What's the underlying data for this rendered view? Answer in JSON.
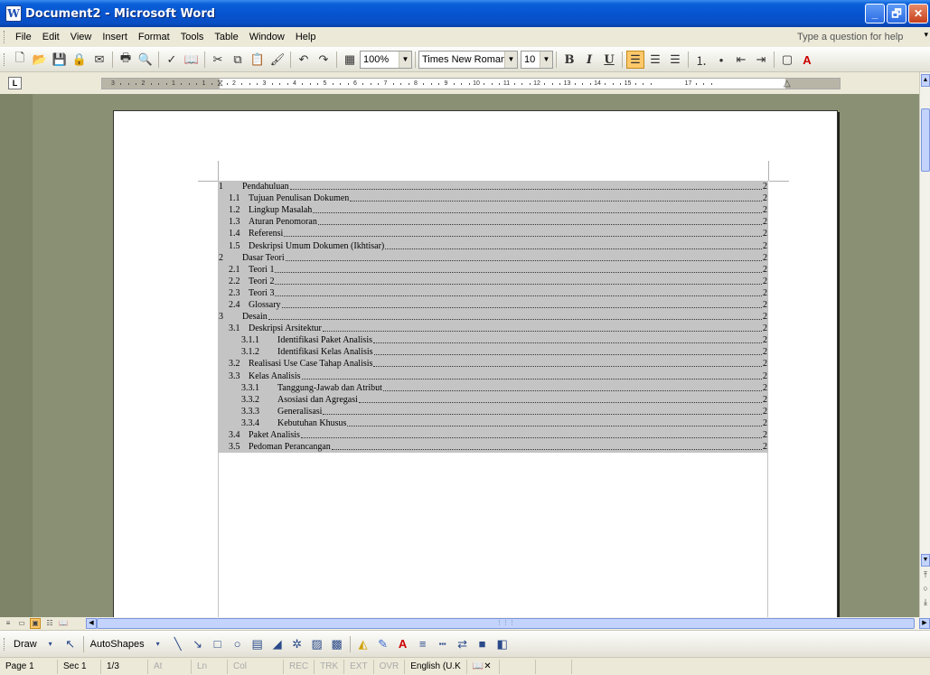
{
  "window": {
    "title": "Document2 - Microsoft Word",
    "app_icon": "word-icon",
    "buttons": [
      "_",
      "🗗",
      "✕"
    ]
  },
  "menu": {
    "items": [
      "File",
      "Edit",
      "View",
      "Insert",
      "Format",
      "Tools",
      "Table",
      "Window",
      "Help"
    ],
    "help_placeholder": "Type a question for help"
  },
  "toolbar": {
    "zoom": "100%",
    "font_name": "Times New Roman",
    "font_size": "10",
    "bold": "B",
    "italic": "I",
    "underline": "U"
  },
  "ruler": {
    "labels": [
      "3",
      "2",
      "1",
      "1",
      "2",
      "3",
      "4",
      "5",
      "6",
      "7",
      "8",
      "9",
      "10",
      "11",
      "12",
      "13",
      "14",
      "15",
      "17"
    ]
  },
  "toc": [
    {
      "num": "1",
      "title": "Pendahuluan",
      "page": "2",
      "level": 1
    },
    {
      "num": "1.1",
      "title": "Tujuan Penulisan Dokumen",
      "page": "2",
      "level": 2
    },
    {
      "num": "1.2",
      "title": "Lingkup Masalah",
      "page": "2",
      "level": 2
    },
    {
      "num": "1.3",
      "title": "Aturan Penomoran",
      "page": "2",
      "level": 2
    },
    {
      "num": "1.4",
      "title": "Referensi",
      "page": "2",
      "level": 2
    },
    {
      "num": "1.5",
      "title": "Deskripsi Umum Dokumen (Ikhtisar)",
      "page": "2",
      "level": 2
    },
    {
      "num": "2",
      "title": "Dasar Teori",
      "page": "2",
      "level": 1
    },
    {
      "num": "2.1",
      "title": "Teori 1",
      "page": "2",
      "level": 2
    },
    {
      "num": "2.2",
      "title": "Teori 2",
      "page": "2",
      "level": 2
    },
    {
      "num": "2.3",
      "title": "Teori 3",
      "page": "2",
      "level": 2
    },
    {
      "num": "2.4",
      "title": "Glossary",
      "page": "2",
      "level": 2
    },
    {
      "num": "3",
      "title": "Desain",
      "page": "2",
      "level": 1
    },
    {
      "num": "3.1",
      "title": "Deskripsi Arsitektur",
      "page": "2",
      "level": 2
    },
    {
      "num": "3.1.1",
      "title": "Identifikasi Paket Analisis",
      "page": "2",
      "level": 3
    },
    {
      "num": "3.1.2",
      "title": "Identifikasi Kelas Analisis",
      "page": "2",
      "level": 3
    },
    {
      "num": "3.2",
      "title": "Realisasi Use Case Tahap Analisis",
      "page": "2",
      "level": 2
    },
    {
      "num": "3.3",
      "title": "Kelas Analisis",
      "page": "2",
      "level": 2
    },
    {
      "num": "3.3.1",
      "title": "Tanggung-Jawab dan Atribut",
      "page": "2",
      "level": 3
    },
    {
      "num": "3.3.2",
      "title": "Asosiasi dan Agregasi",
      "page": "2",
      "level": 3
    },
    {
      "num": "3.3.3",
      "title": "Generalisasi",
      "page": "2",
      "level": 3
    },
    {
      "num": "3.3.4",
      "title": "Kebutuhan Khusus",
      "page": "2",
      "level": 3
    },
    {
      "num": "3.4",
      "title": "Paket Analisis",
      "page": "2",
      "level": 2
    },
    {
      "num": "3.5",
      "title": "Pedoman Perancangan",
      "page": "2",
      "level": 2
    }
  ],
  "drawbar": {
    "draw_label": "Draw",
    "autoshapes_label": "AutoShapes"
  },
  "status": {
    "page": "Page 1",
    "sec": "Sec 1",
    "pages": "1/3",
    "at": "At",
    "ln": "Ln",
    "col": "Col",
    "rec": "REC",
    "trk": "TRK",
    "ext": "EXT",
    "ovr": "OVR",
    "language": "English (U.K"
  }
}
